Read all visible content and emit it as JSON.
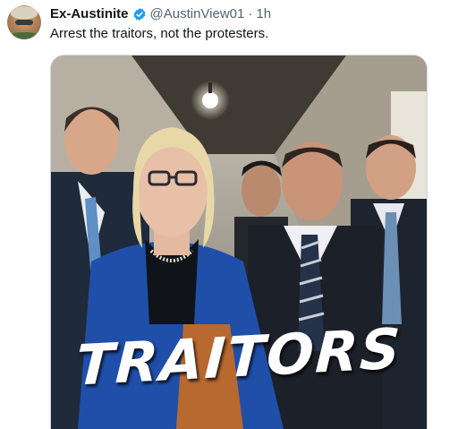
{
  "post": {
    "display_name": "Ex-Austinite",
    "handle": "@AustinView01",
    "separator": "·",
    "time": "1h",
    "text": "Arrest the traitors, not the protesters."
  },
  "media": {
    "overlay_text": "TRAITORS"
  },
  "colors": {
    "verified_badge": "#1d9bf0",
    "secondary_text": "#536471",
    "primary_text": "#0f1419",
    "media_border": "#cfd9de"
  }
}
